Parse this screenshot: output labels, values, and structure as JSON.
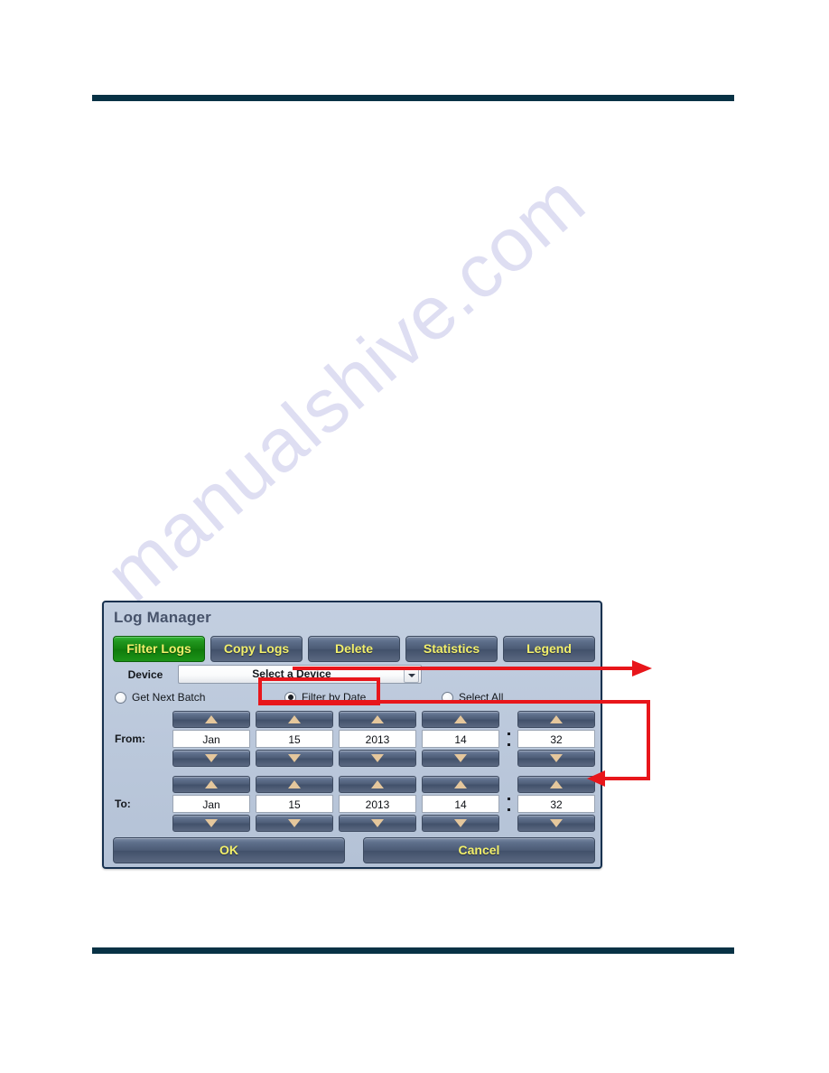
{
  "page": {
    "watermark_text": "manualshive.com",
    "rule_color": "#083245"
  },
  "dialog": {
    "title": "Log Manager",
    "tabs": [
      {
        "label": "Filter Logs",
        "active": true
      },
      {
        "label": "Copy Logs",
        "active": false
      },
      {
        "label": "Delete",
        "active": false
      },
      {
        "label": "Statistics",
        "active": false
      },
      {
        "label": "Legend",
        "active": false
      }
    ],
    "device": {
      "label": "Device",
      "selected": "Select a Device"
    },
    "mode_options": [
      {
        "label": "Get Next Batch",
        "selected": false
      },
      {
        "label": "Filter by Date",
        "selected": true
      },
      {
        "label": "Select All",
        "selected": false
      }
    ],
    "from": {
      "label": "From:",
      "month": "Jan",
      "day": "15",
      "year": "2013",
      "hour": "14",
      "minute": "32"
    },
    "to": {
      "label": "To:",
      "month": "Jan",
      "day": "15",
      "year": "2013",
      "hour": "14",
      "minute": "32"
    },
    "actions": {
      "ok": "OK",
      "cancel": "Cancel"
    },
    "colors": {
      "active_tab": "#14820f",
      "tab": "#4c5b75",
      "tab_text": "#f2ef6b",
      "panel": "#bcc9dc",
      "border": "#17314f",
      "arrow_fill": "#e5c79c"
    }
  },
  "annotations": {
    "callout_color": "#e8161b",
    "items": [
      {
        "name": "device-dropdown-callout"
      },
      {
        "name": "filter-by-date-callout"
      }
    ]
  }
}
